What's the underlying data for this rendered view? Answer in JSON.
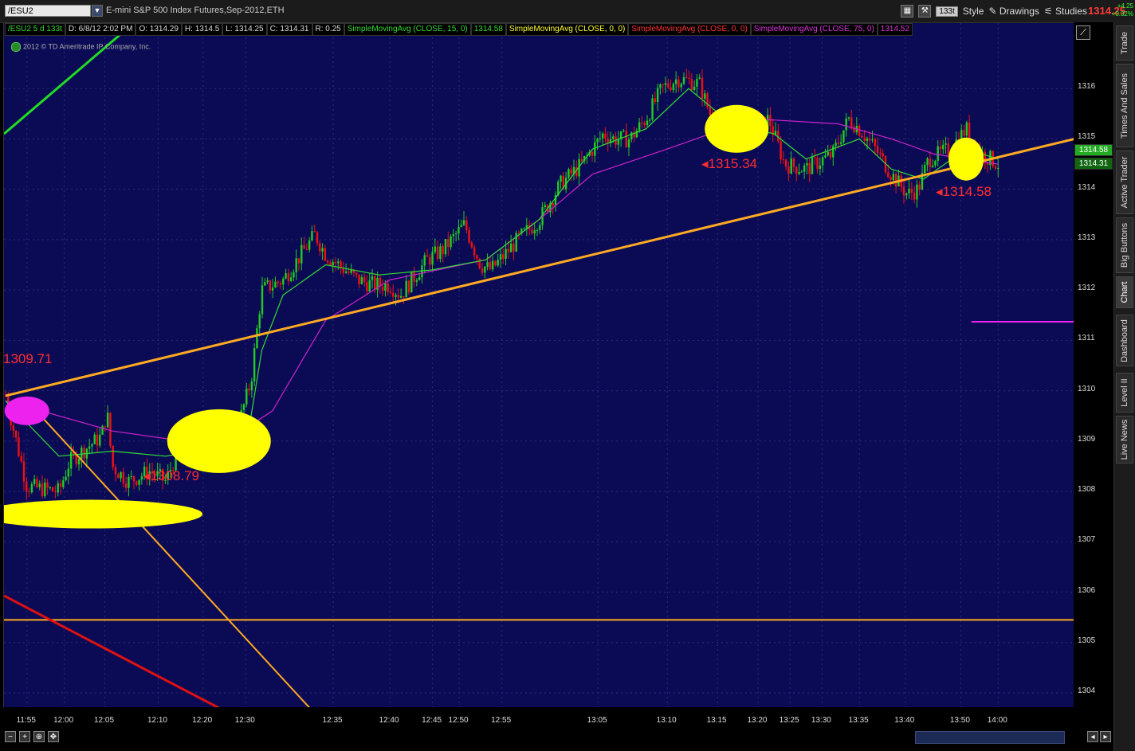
{
  "header": {
    "symbol": "/ESU2",
    "description": "E-mini S&P 500 Index Futures,Sep-2012,ETH",
    "tick_badge": "133t",
    "style_label": "Style",
    "drawings_label": "Drawings",
    "studies_label": "Studies",
    "last_price": "1314.25",
    "change_abs": "+4.25",
    "change_pct": "+0.32%"
  },
  "legend": {
    "symbol": "/ESU2 5 d 133t",
    "date": "D: 6/8/12 2:02 PM",
    "open": "O: 1314.29",
    "high": "H: 1314.5",
    "low": "L: 1314.25",
    "close": "C: 1314.31",
    "range": "R: 0.25",
    "sma15": "SimpleMovingAvg (CLOSE, 15, 0)",
    "sma15_val": "1314.58",
    "sma0a": "SimpleMovingAvg (CLOSE, 0, 0)",
    "sma0b": "SimpleMovingAvg (CLOSE, 0, 0)",
    "sma75": "SimpleMovingAvg (CLOSE, 75, 0)",
    "sma75_val": "1314.52"
  },
  "copyright": "2012 © TD Ameritrade IP Company, Inc.",
  "side_tabs": [
    "Trade",
    "Times And Sales",
    "Active Trader",
    "Big Buttons",
    "Chart",
    "Dashboard",
    "Level II",
    "Live News"
  ],
  "active_tab": "Chart",
  "colors": {
    "background": "#0b0b55",
    "up_candle": "#22cc22",
    "down_candle": "#ee1111",
    "sma15": "#33dd33",
    "sma75": "#cc22cc",
    "trendline": "#ffaa22",
    "highlight": "#ffff00"
  },
  "chart_data": {
    "type": "candlestick",
    "ylim": [
      1303.7,
      1317.3
    ],
    "y_ticks": [
      "1316",
      "1315",
      "1314",
      "1313",
      "1312",
      "1311",
      "1310",
      "1309",
      "1308",
      "1307",
      "1306",
      "1305",
      "1304"
    ],
    "x_ticks": [
      "11:55",
      "12:00",
      "12:05",
      "12:10",
      "12:20",
      "12:30",
      "12:35",
      "12:40",
      "12:45",
      "12:50",
      "12:55",
      "13:05",
      "13:10",
      "13:15",
      "13:20",
      "13:25",
      "13:30",
      "13:35",
      "13:40",
      "13:50",
      "14:00"
    ],
    "price_path": [
      [
        0,
        1309.9
      ],
      [
        0.02,
        1308.1
      ],
      [
        0.05,
        1308.0
      ],
      [
        0.06,
        1308.6
      ],
      [
        0.09,
        1309.1
      ],
      [
        0.095,
        1309.6
      ],
      [
        0.1,
        1308.5
      ],
      [
        0.115,
        1308.2
      ],
      [
        0.135,
        1308.4
      ],
      [
        0.15,
        1308.2
      ],
      [
        0.165,
        1309.0
      ],
      [
        0.19,
        1308.8
      ],
      [
        0.21,
        1308.7
      ],
      [
        0.23,
        1310.2
      ],
      [
        0.24,
        1312.0
      ],
      [
        0.26,
        1312.2
      ],
      [
        0.28,
        1312.8
      ],
      [
        0.29,
        1313.1
      ],
      [
        0.3,
        1312.7
      ],
      [
        0.33,
        1312.2
      ],
      [
        0.345,
        1312.1
      ],
      [
        0.36,
        1312.1
      ],
      [
        0.37,
        1311.9
      ],
      [
        0.395,
        1312.6
      ],
      [
        0.41,
        1312.8
      ],
      [
        0.43,
        1313.3
      ],
      [
        0.445,
        1312.5
      ],
      [
        0.455,
        1312.4
      ],
      [
        0.48,
        1313.0
      ],
      [
        0.5,
        1313.4
      ],
      [
        0.52,
        1314.1
      ],
      [
        0.54,
        1314.5
      ],
      [
        0.56,
        1315.1
      ],
      [
        0.57,
        1315.0
      ],
      [
        0.585,
        1315.0
      ],
      [
        0.6,
        1315.4
      ],
      [
        0.615,
        1316.0
      ],
      [
        0.63,
        1316.2
      ],
      [
        0.65,
        1316.1
      ],
      [
        0.66,
        1315.5
      ],
      [
        0.68,
        1315.1
      ],
      [
        0.7,
        1315.1
      ],
      [
        0.715,
        1315.4
      ],
      [
        0.73,
        1314.5
      ],
      [
        0.75,
        1314.4
      ],
      [
        0.775,
        1314.7
      ],
      [
        0.79,
        1315.4
      ],
      [
        0.8,
        1315.2
      ],
      [
        0.815,
        1314.8
      ],
      [
        0.83,
        1314.3
      ],
      [
        0.845,
        1313.9
      ],
      [
        0.855,
        1314.0
      ],
      [
        0.865,
        1314.6
      ],
      [
        0.885,
        1314.8
      ],
      [
        0.9,
        1315.2
      ],
      [
        0.915,
        1314.7
      ],
      [
        0.93,
        1314.5
      ]
    ],
    "sma15_path": [
      [
        0,
        1309.8
      ],
      [
        0.05,
        1308.7
      ],
      [
        0.1,
        1308.8
      ],
      [
        0.15,
        1308.7
      ],
      [
        0.21,
        1308.9
      ],
      [
        0.23,
        1309.5
      ],
      [
        0.24,
        1310.8
      ],
      [
        0.26,
        1311.9
      ],
      [
        0.3,
        1312.5
      ],
      [
        0.35,
        1312.3
      ],
      [
        0.4,
        1312.4
      ],
      [
        0.45,
        1312.6
      ],
      [
        0.5,
        1313.4
      ],
      [
        0.55,
        1314.8
      ],
      [
        0.6,
        1315.2
      ],
      [
        0.64,
        1316.0
      ],
      [
        0.68,
        1315.3
      ],
      [
        0.72,
        1315.1
      ],
      [
        0.75,
        1314.6
      ],
      [
        0.8,
        1315.0
      ],
      [
        0.83,
        1314.4
      ],
      [
        0.86,
        1314.2
      ],
      [
        0.9,
        1314.8
      ],
      [
        0.93,
        1314.6
      ]
    ],
    "sma75_path": [
      [
        0,
        1309.8
      ],
      [
        0.1,
        1309.2
      ],
      [
        0.2,
        1308.9
      ],
      [
        0.25,
        1309.6
      ],
      [
        0.3,
        1311.4
      ],
      [
        0.36,
        1312.2
      ],
      [
        0.45,
        1312.6
      ],
      [
        0.5,
        1313.4
      ],
      [
        0.55,
        1314.3
      ],
      [
        0.62,
        1314.8
      ],
      [
        0.7,
        1315.4
      ],
      [
        0.78,
        1315.3
      ],
      [
        0.83,
        1315.0
      ],
      [
        0.87,
        1314.7
      ],
      [
        0.93,
        1314.5
      ]
    ],
    "current_sma15": "1314.58",
    "current_close": "1314.31",
    "annotations": [
      {
        "text": "1309.71",
        "kind": "label"
      },
      {
        "text": "1308.79",
        "kind": "marker"
      },
      {
        "text": "1315.34",
        "kind": "marker"
      },
      {
        "text": "1314.58",
        "kind": "marker"
      }
    ]
  }
}
